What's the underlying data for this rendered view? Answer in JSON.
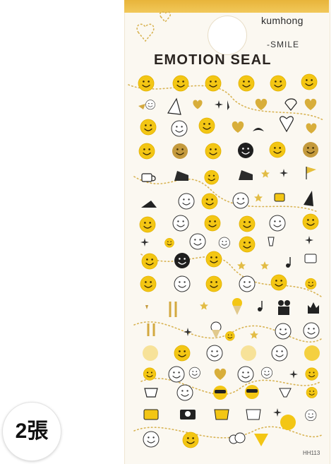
{
  "product": {
    "brand": "kumhong",
    "subtitle": "-SMILE",
    "title": "EMOTION SEAL",
    "code": "HH113"
  },
  "badge": {
    "label": "2張"
  },
  "colors": {
    "sticker_yellow": "#f3c614",
    "sticker_gold": "#caa13b",
    "sticker_black": "#222222",
    "sheet_background": "#fbf8f1",
    "top_band": "#e8b43a"
  },
  "icons": [
    "smiley-face-icon",
    "heart-icon",
    "star-icon",
    "sparkle-icon",
    "coffee-cup-icon",
    "cake-slice-icon",
    "flag-icon",
    "camera-icon",
    "clapperboard-icon",
    "ice-cream-cone-icon",
    "champagne-glass-icon",
    "music-note-icon",
    "fork-and-spoon-icon",
    "shopping-bag-icon",
    "sunglasses-icon",
    "party-hat-icon",
    "bird-icon",
    "crown-icon",
    "cloud-icon"
  ]
}
